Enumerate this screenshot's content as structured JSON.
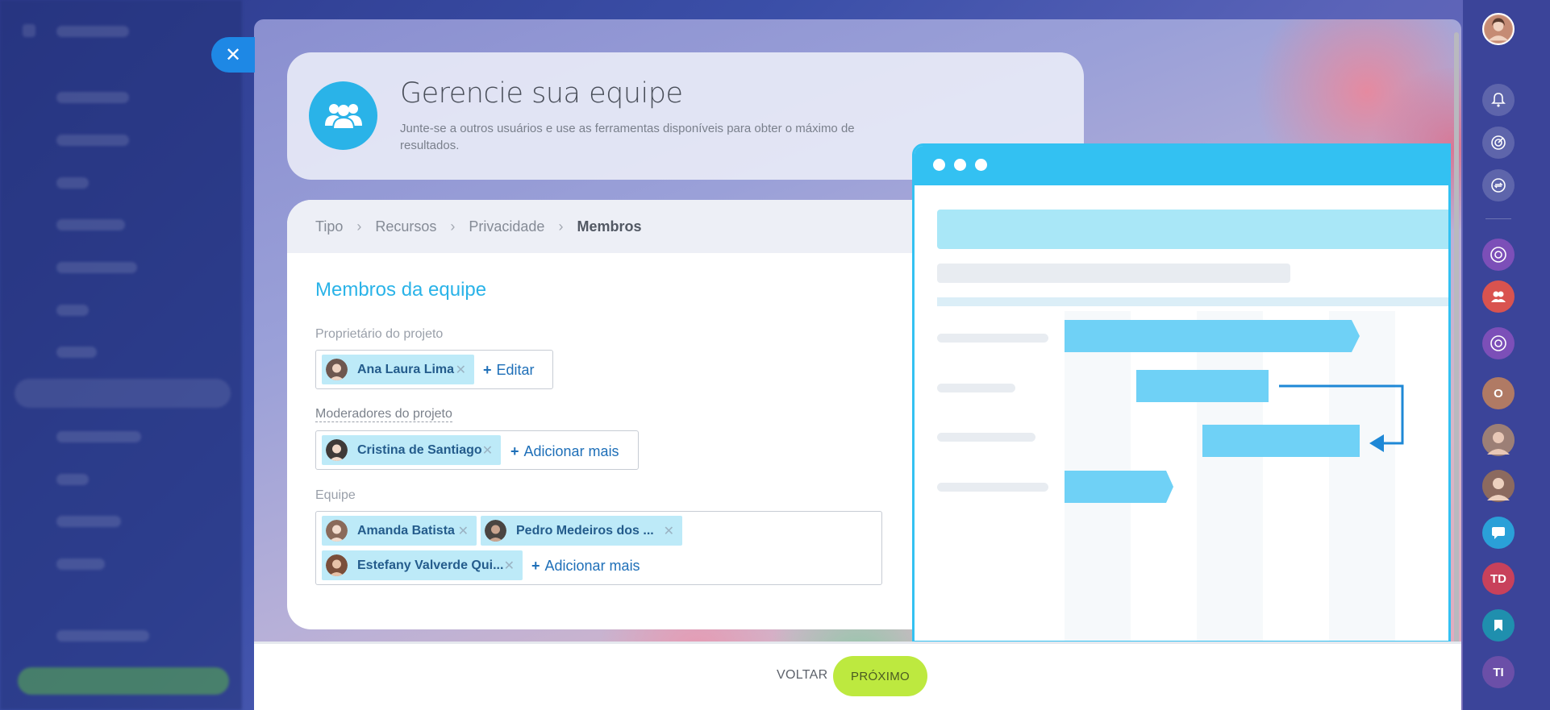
{
  "header": {
    "title": "Gerencie sua equipe",
    "subtitle": "Junte-se a outros usuários e use as ferramentas disponíveis para obter o máximo de resultados."
  },
  "breadcrumb": [
    "Tipo",
    "Recursos",
    "Privacidade",
    "Membros"
  ],
  "section_title": "Membros da equipe",
  "owner": {
    "label": "Proprietário do projeto",
    "members": [
      "Ana Laura Lima"
    ],
    "action": "Editar"
  },
  "moderators": {
    "label": "Moderadores do projeto",
    "members": [
      "Cristina de Santiago"
    ],
    "action": "Adicionar mais"
  },
  "team": {
    "label": "Equipe",
    "members": [
      "Amanda Batista",
      "Pedro Medeiros dos ...",
      "Estefany Valverde Qui..."
    ],
    "action": "Adicionar mais"
  },
  "footer": {
    "back_label": "VOLTAR",
    "next_label": "PRÓXIMO"
  },
  "rail": {
    "avatar_o": "O",
    "avatar_td": "TD",
    "avatar_ti": "TI"
  },
  "colors": {
    "accent": "#2ab3e8",
    "link": "#1e6fb8",
    "chip": "#bdeaf8",
    "next_button": "#bde93f",
    "preview_frame": "#33c1f2"
  }
}
